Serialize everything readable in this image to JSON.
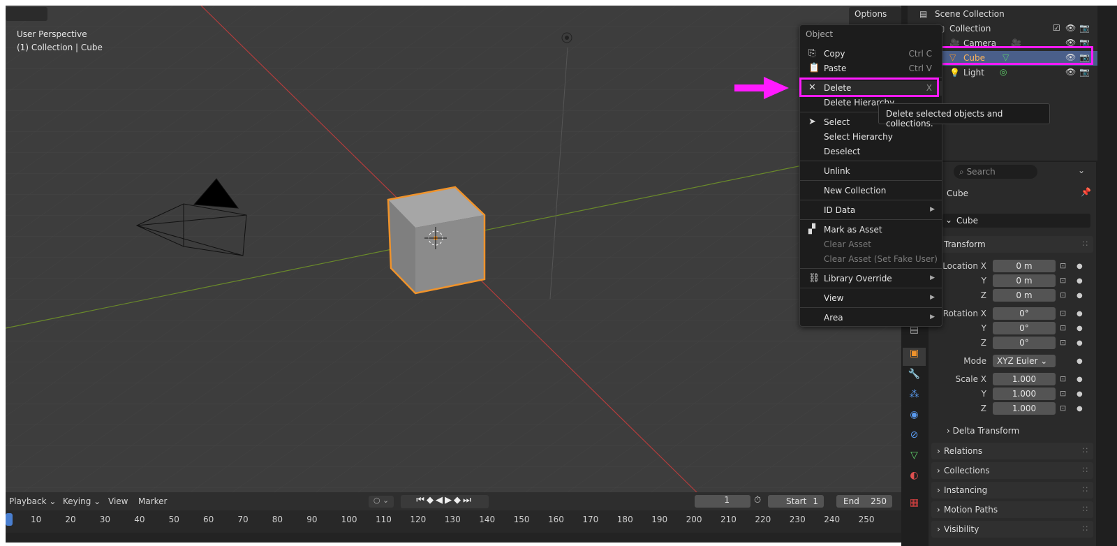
{
  "viewport": {
    "perspective": "User Perspective",
    "collection_label": "(1) Collection | Cube",
    "options_label": "Options",
    "options_chevron": "⌄"
  },
  "timeline": {
    "playback": "Playback",
    "keying": "Keying",
    "view": "View",
    "marker": "Marker",
    "current_frame": "1",
    "start_label": "Start",
    "start_value": "1",
    "end_label": "End",
    "end_value": "250",
    "ticks": [
      "10",
      "20",
      "30",
      "40",
      "50",
      "60",
      "70",
      "80",
      "90",
      "100",
      "110",
      "120",
      "130",
      "140",
      "150",
      "160",
      "170",
      "180",
      "190",
      "200",
      "210",
      "220",
      "230",
      "240",
      "250"
    ]
  },
  "outliner": {
    "scene_collection": "Scene Collection",
    "collection": "Collection",
    "camera": "Camera",
    "cube": "Cube",
    "light": "Light"
  },
  "menu": {
    "title": "Object",
    "copy": "Copy",
    "copy_sc": "Ctrl C",
    "paste": "Paste",
    "paste_sc": "Ctrl V",
    "delete": "Delete",
    "delete_sc": "X",
    "delete_hierarchy": "Delete Hierarchy",
    "select": "Select",
    "select_hierarchy": "Select Hierarchy",
    "deselect": "Deselect",
    "unlink": "Unlink",
    "new_collection": "New Collection",
    "id_data": "ID Data",
    "mark_as_asset": "Mark as Asset",
    "clear_asset": "Clear Asset",
    "clear_asset_fake": "Clear Asset (Set Fake User)",
    "library_override": "Library Override",
    "view": "View",
    "area": "Area"
  },
  "tooltip": "Delete selected objects and collections.",
  "properties": {
    "search_placeholder": "Search",
    "object_name": "Cube",
    "object_field": "Cube",
    "transform": "Transform",
    "location_x_label": "Location X",
    "location_x": "0 m",
    "location_y_label": "Y",
    "location_y": "0 m",
    "location_z_label": "Z",
    "location_z": "0 m",
    "rotation_x_label": "Rotation X",
    "rotation_x": "0°",
    "rotation_y_label": "Y",
    "rotation_y": "0°",
    "rotation_z_label": "Z",
    "rotation_z": "0°",
    "mode_label": "Mode",
    "mode": "XYZ Euler",
    "scale_x_label": "Scale X",
    "scale_x": "1.000",
    "scale_y_label": "Y",
    "scale_y": "1.000",
    "scale_z_label": "Z",
    "scale_z": "1.000",
    "delta_transform": "Delta Transform",
    "relations": "Relations",
    "collections": "Collections",
    "instancing": "Instancing",
    "motion_paths": "Motion Paths",
    "visibility": "Visibility"
  },
  "colors": {
    "accent_orange": "#f0932b",
    "highlight_magenta": "#ff1aff",
    "selected_row": "#4a5f8a"
  }
}
